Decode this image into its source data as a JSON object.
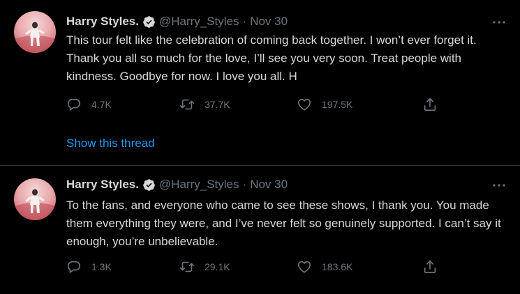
{
  "tweets": [
    {
      "author": {
        "name": "Harry Styles.",
        "handle": "@Harry_Styles",
        "verified": true
      },
      "separator": "·",
      "date": "Nov 30",
      "text": "This tour felt like the celebration of coming back together. I won’t ever forget it. Thank you all so much for the love, I’ll see you very soon. Treat people with kindness. Goodbye for now. I love you all. H",
      "stats": {
        "replies": "4.7K",
        "retweets": "37.7K",
        "likes": "197.5K"
      },
      "show_thread": "Show this thread"
    },
    {
      "author": {
        "name": "Harry Styles.",
        "handle": "@Harry_Styles",
        "verified": true
      },
      "separator": "·",
      "date": "Nov 30",
      "text": "To the fans, and everyone who came to see these shows, I thank you. You made them everything they were, and I’ve never felt so genuinely supported. I can’t say it enough, you’re unbelievable.",
      "stats": {
        "replies": "1.3K",
        "retweets": "29.1K",
        "likes": "183.6K"
      }
    }
  ],
  "icons": {
    "verified": "verified-badge-icon",
    "more": "more-options-icon",
    "reply": "reply-icon",
    "retweet": "retweet-icon",
    "like": "heart-icon",
    "share": "share-icon"
  },
  "colors": {
    "background": "#000000",
    "text": "#d9d9d9",
    "muted": "#6e767d",
    "link": "#1d9bf0",
    "divider": "#2f3336"
  }
}
